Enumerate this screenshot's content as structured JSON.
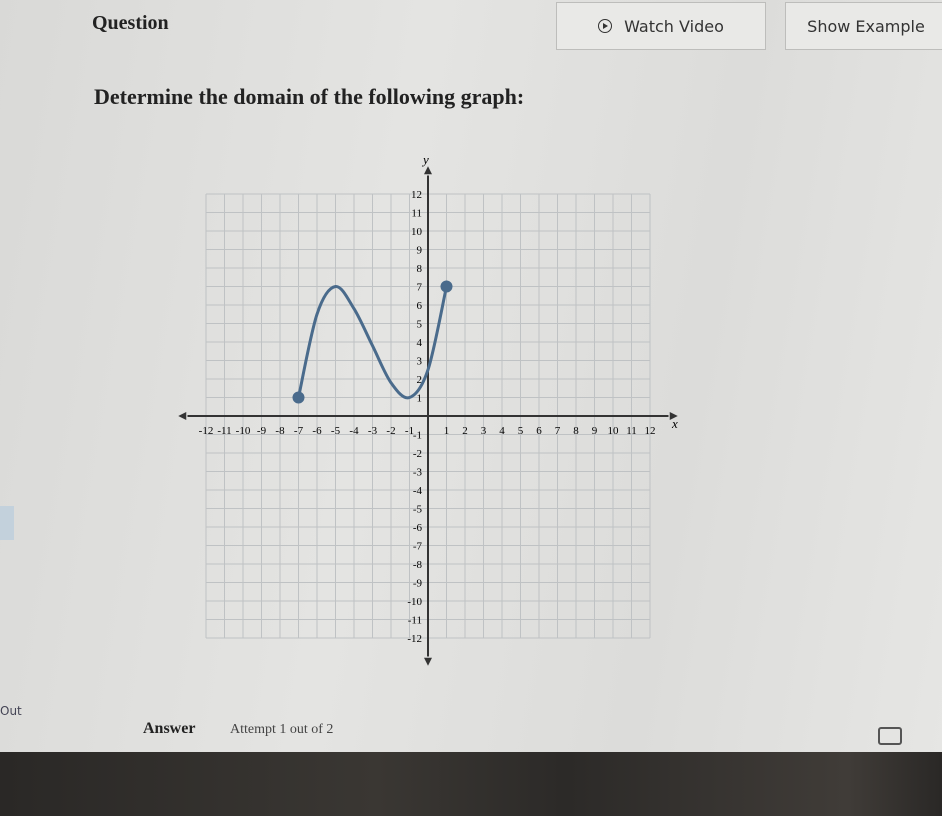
{
  "header": {
    "title": "Question",
    "watch_video": "Watch Video",
    "show_example": "Show Example"
  },
  "question": {
    "prompt": "Determine the domain of the following graph:"
  },
  "colors": {
    "curve": "#4a6b8c",
    "axis": "#333333",
    "grid": "#bfc2c4"
  },
  "chart_data": {
    "type": "line",
    "xlabel": "x",
    "ylabel": "y",
    "xlim": [
      -12,
      12
    ],
    "ylim": [
      -12,
      12
    ],
    "grid": true,
    "x_ticks": [
      -12,
      -11,
      -10,
      -9,
      -8,
      -7,
      -6,
      -5,
      -4,
      -3,
      -2,
      -1,
      1,
      2,
      3,
      4,
      5,
      6,
      7,
      8,
      9,
      10,
      11,
      12
    ],
    "y_ticks": [
      -12,
      -11,
      -10,
      -9,
      -8,
      -7,
      -6,
      -5,
      -4,
      -3,
      -2,
      -1,
      1,
      2,
      3,
      4,
      5,
      6,
      7,
      8,
      9,
      10,
      11,
      12
    ],
    "series": [
      {
        "points": [
          [
            -7,
            1
          ],
          [
            -6,
            5.5
          ],
          [
            -5,
            7
          ],
          [
            -4,
            5.8
          ],
          [
            -3,
            3.8
          ],
          [
            -2,
            1.8
          ],
          [
            -1,
            1
          ],
          [
            0,
            2.5
          ],
          [
            1,
            7
          ]
        ],
        "endpoints": [
          {
            "x": -7,
            "y": 1,
            "closed": true
          },
          {
            "x": 1,
            "y": 7,
            "closed": true
          }
        ]
      }
    ]
  },
  "left_edge_text": "Out",
  "answer": {
    "label": "Answer",
    "attempt": "Attempt 1 out of 2"
  }
}
